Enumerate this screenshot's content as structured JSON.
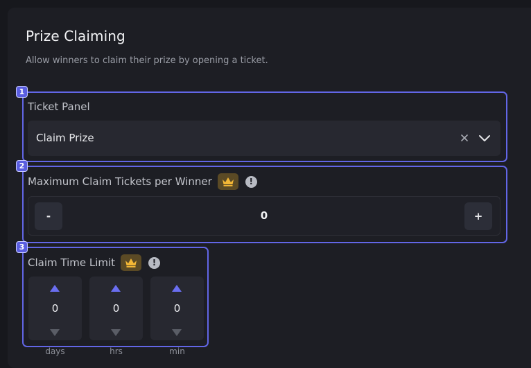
{
  "section": {
    "title": "Prize Claiming",
    "subtitle": "Allow winners to claim their prize by opening a ticket."
  },
  "ticket_panel": {
    "step": "1",
    "label": "Ticket Panel",
    "selected": "Claim Prize",
    "icons": [
      "close-icon",
      "chevron-down-icon"
    ]
  },
  "max_claim": {
    "step": "2",
    "label": "Maximum Claim Tickets per Winner",
    "decrement": "-",
    "increment": "+",
    "value": "0",
    "premium_icon": "crown-icon",
    "info_icon": "info-icon",
    "info_glyph": "!"
  },
  "time_limit": {
    "step": "3",
    "label": "Claim Time Limit",
    "premium_icon": "crown-icon",
    "info_icon": "info-icon",
    "info_glyph": "!",
    "fields": [
      {
        "value": "0",
        "unit": "days"
      },
      {
        "value": "0",
        "unit": "hrs"
      },
      {
        "value": "0",
        "unit": "min"
      }
    ]
  },
  "colors": {
    "highlight_border": "#6266e6",
    "arrow_active": "#6a6ef0",
    "arrow_inactive": "#5a5d66",
    "premium_bg": "#5b4a25",
    "crown": "#f3b736"
  }
}
